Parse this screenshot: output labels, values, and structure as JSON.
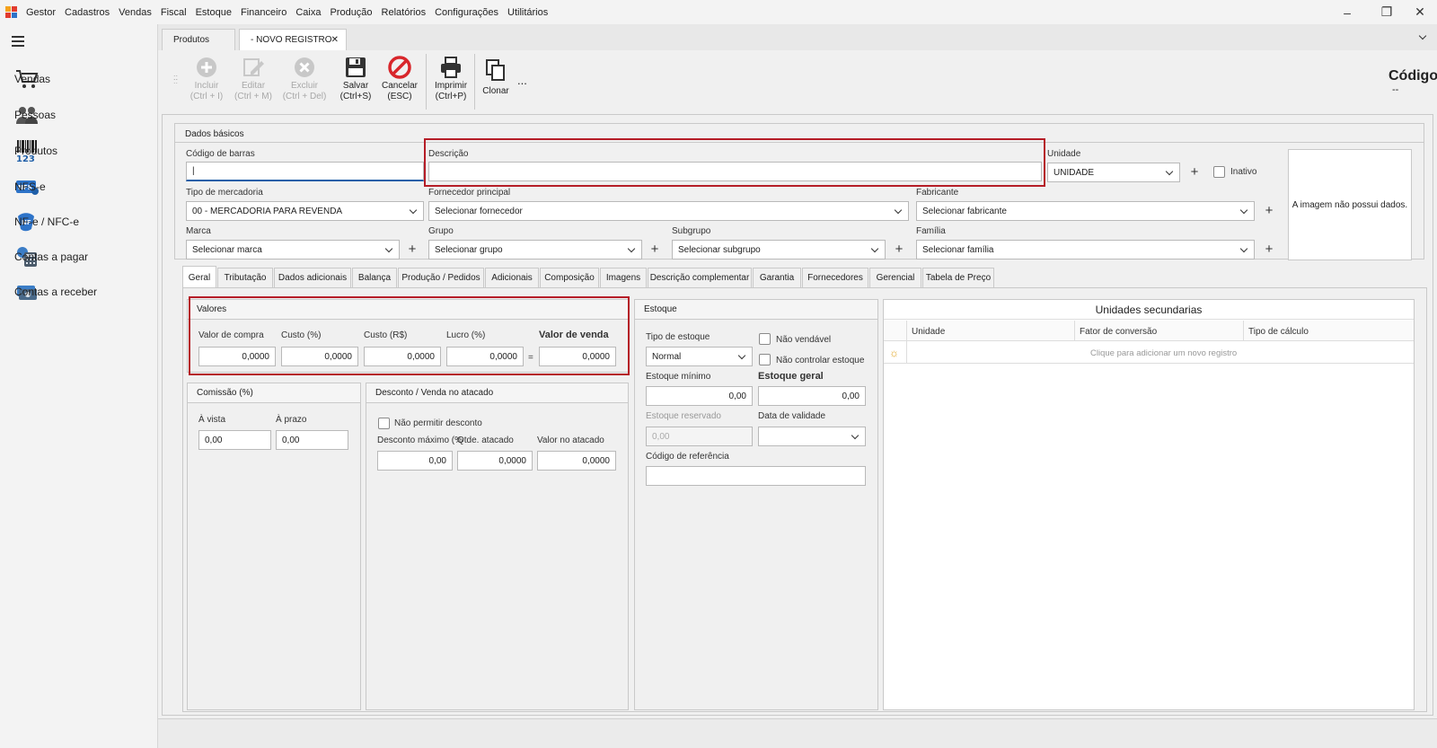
{
  "menubar": {
    "app_name": "Gestor",
    "items": [
      "Cadastros",
      "Vendas",
      "Fiscal",
      "Estoque",
      "Financeiro",
      "Caixa",
      "Produção",
      "Relatórios",
      "Configurações",
      "Utilitários"
    ]
  },
  "sidebar": {
    "items": [
      {
        "label": "Vendas",
        "icon": "cart-icon"
      },
      {
        "label": "Pessoas",
        "icon": "people-icon"
      },
      {
        "label": "Produtos",
        "icon": "barcode-icon"
      },
      {
        "label": "NFS-e",
        "icon": "nfse-icon"
      },
      {
        "label": "NF-e / NFC-e",
        "icon": "nfe-icon"
      },
      {
        "label": "Contas a pagar",
        "icon": "calculator-icon"
      },
      {
        "label": "Contas a receber",
        "icon": "cash-icon"
      }
    ]
  },
  "doc_tabs": {
    "products": "Produtos",
    "new_record": "- NOVO REGISTRO",
    "close": "✕"
  },
  "toolbar": {
    "include": {
      "l1": "Incluir",
      "l2": "(Ctrl + I)"
    },
    "edit": {
      "l1": "Editar",
      "l2": "(Ctrl + M)"
    },
    "delete": {
      "l1": "Excluir",
      "l2": "(Ctrl + Del)"
    },
    "save": {
      "l1": "Salvar",
      "l2": "(Ctrl+S)"
    },
    "cancel": {
      "l1": "Cancelar",
      "l2": "(ESC)"
    },
    "print": {
      "l1": "Imprimir",
      "l2": "(Ctrl+P)"
    },
    "clone": {
      "l1": "Clonar"
    },
    "more": "..."
  },
  "code_header": {
    "label": "Código",
    "value": "--"
  },
  "basic": {
    "title": "Dados básicos",
    "barcode_label": "Código de barras",
    "barcode_value": "|",
    "description_label": "Descrição",
    "description_value": "",
    "unit_label": "Unidade",
    "unit_value": "UNIDADE",
    "inactive_label": "Inativo",
    "image_text": "A imagem não possui dados.",
    "goods_type_label": "Tipo de mercadoria",
    "goods_type_value": "00 - MERCADORIA PARA REVENDA",
    "supplier_label": "Fornecedor principal",
    "supplier_value": "Selecionar fornecedor",
    "maker_label": "Fabricante",
    "maker_value": "Selecionar fabricante",
    "brand_label": "Marca",
    "brand_value": "Selecionar marca",
    "group_label": "Grupo",
    "group_value": "Selecionar grupo",
    "subgroup_label": "Subgrupo",
    "subgroup_value": "Selecionar subgrupo",
    "family_label": "Família",
    "family_value": "Selecionar família"
  },
  "tabs": [
    "Geral",
    "Tributação",
    "Dados adicionais",
    "Balança",
    "Produção / Pedidos",
    "Adicionais",
    "Composição",
    "Imagens",
    "Descrição complementar",
    "Garantia",
    "Fornecedores",
    "Gerencial",
    "Tabela de Preço"
  ],
  "values": {
    "title": "Valores",
    "buy_label": "Valor de compra",
    "buy_value": "0,0000",
    "cost_pct_label": "Custo (%)",
    "cost_pct_value": "0,0000",
    "cost_rs_label": "Custo (R$)",
    "cost_rs_value": "0,0000",
    "profit_label": "Lucro (%)",
    "profit_value": "0,0000",
    "equals": "=",
    "sale_label": "Valor de venda",
    "sale_value": "0,0000"
  },
  "commission": {
    "title": "Comissão (%)",
    "cash_label": "À vista",
    "cash_value": "0,00",
    "term_label": "À prazo",
    "term_value": "0,00"
  },
  "discount": {
    "title": "Desconto / Venda no atacado",
    "no_discount_label": "Não permitir desconto",
    "max_label": "Desconto máximo (%",
    "max_value": "0,00",
    "qty_label": "Qtde. atacado",
    "qty_value": "0,0000",
    "wholesale_label": "Valor no atacado",
    "wholesale_value": "0,0000"
  },
  "stock": {
    "title": "Estoque",
    "type_label": "Tipo de estoque",
    "type_value": "Normal",
    "not_sellable_label": "Não vendável",
    "no_control_label": "Não controlar estoque",
    "min_label": "Estoque mínimo",
    "min_value": "0,00",
    "general_label": "Estoque geral",
    "general_value": "0,00",
    "reserved_label": "Estoque reservado",
    "reserved_value": "0,00",
    "validity_label": "Data de validade",
    "ref_label": "Código de referência"
  },
  "secondary_units": {
    "title": "Unidades secundarias",
    "col_unit": "Unidade",
    "col_factor": "Fator de conversão",
    "col_calc": "Tipo de cálculo",
    "add_hint": "Clique para adicionar um novo registro"
  },
  "colors": {
    "highlight": "#b51d27",
    "accent_blue": "#1f5fa8"
  }
}
